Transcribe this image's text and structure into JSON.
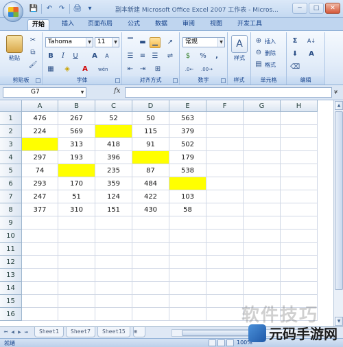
{
  "window": {
    "title": "副本新建 Microsoft Office Excel 2007 工作表 - Micros...",
    "minimize": "─",
    "maximize": "□",
    "close": "✕"
  },
  "quick_access": {
    "save": "💾",
    "undo": "↶",
    "redo": "↷",
    "print_preview": "🖨",
    "customize": "▾"
  },
  "tabs": [
    "开始",
    "插入",
    "页面布局",
    "公式",
    "数据",
    "审阅",
    "视图",
    "开发工具"
  ],
  "ribbon": {
    "clipboard": {
      "label": "剪贴板",
      "paste": "粘贴"
    },
    "font": {
      "label": "字体",
      "name": "Tahoma",
      "size": "11",
      "bold": "B",
      "italic": "I",
      "underline": "U",
      "grow": "A",
      "shrink": "A",
      "font_color_letter": "A",
      "phonetic": "wén"
    },
    "alignment": {
      "label": "对齐方式"
    },
    "number": {
      "label": "数字",
      "format": "常规",
      "currency": "$",
      "percent": "%",
      "comma": ","
    },
    "styles": {
      "label": "样式",
      "styles_button": "样式"
    },
    "cells": {
      "label": "单元格",
      "insert": "插入",
      "delete": "删除",
      "format": "格式"
    },
    "editing": {
      "label": "编辑",
      "sum": "Σ",
      "sort": "A↓",
      "find": "A"
    }
  },
  "formula_bar": {
    "name_box": "G7",
    "fx": "fx",
    "formula": ""
  },
  "grid": {
    "columns": [
      "A",
      "B",
      "C",
      "D",
      "E",
      "F",
      "G",
      "H"
    ],
    "rows": [
      "1",
      "2",
      "3",
      "4",
      "5",
      "6",
      "7",
      "8",
      "9",
      "10",
      "11",
      "12",
      "13",
      "14",
      "15",
      "16"
    ],
    "cells": [
      [
        "476",
        "267",
        "52",
        "50",
        "563",
        "",
        "",
        ""
      ],
      [
        "224",
        "569",
        "",
        "115",
        "379",
        "",
        "",
        ""
      ],
      [
        "",
        "313",
        "418",
        "91",
        "502",
        "",
        "",
        ""
      ],
      [
        "297",
        "193",
        "396",
        "",
        "179",
        "",
        "",
        ""
      ],
      [
        "74",
        "",
        "235",
        "87",
        "538",
        "",
        "",
        ""
      ],
      [
        "293",
        "170",
        "359",
        "484",
        "",
        "",
        "",
        ""
      ],
      [
        "247",
        "51",
        "124",
        "422",
        "103",
        "",
        "",
        ""
      ],
      [
        "377",
        "310",
        "151",
        "430",
        "58",
        "",
        "",
        ""
      ]
    ],
    "highlighted": [
      [
        1,
        2
      ],
      [
        2,
        0
      ],
      [
        3,
        3
      ],
      [
        4,
        1
      ],
      [
        5,
        4
      ]
    ],
    "highlight_color": "#ffff00"
  },
  "sheets": [
    "Sheet1",
    "Sheet7",
    "Sheet15"
  ],
  "status": {
    "text": "就绪",
    "zoom": "100%"
  },
  "watermark": {
    "text": "软件技巧",
    "brand": "元码手游网"
  },
  "colors": {
    "ribbon_bg": "#e3edf9",
    "accent": "#15428b"
  }
}
